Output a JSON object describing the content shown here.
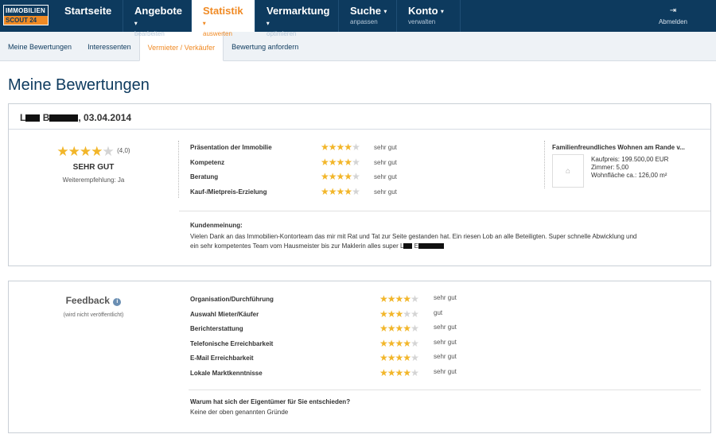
{
  "logo": {
    "line1": "IMMOBILIEN",
    "line2": "SCOUT 24"
  },
  "nav": [
    {
      "label": "Startseite",
      "sub": "",
      "active": false,
      "caret": ""
    },
    {
      "label": "Angebote",
      "sub": "bearbeiten",
      "active": false,
      "caret": "▾"
    },
    {
      "label": "Statistik",
      "sub": "auswerten",
      "active": true,
      "caret": "▾"
    },
    {
      "label": "Vermarktung",
      "sub": "optimieren",
      "active": false,
      "caret": "▾"
    },
    {
      "label": "Suche",
      "sub": "anpassen",
      "active": false,
      "caret": "▾"
    },
    {
      "label": "Konto",
      "sub": "verwalten",
      "active": false,
      "caret": "▾"
    }
  ],
  "logout": {
    "label": "Abmelden",
    "icon": "logout-icon"
  },
  "subnav": [
    {
      "label": "Meine Bewertungen",
      "active": false
    },
    {
      "label": "Interessenten",
      "active": false
    },
    {
      "label": "Vermieter / Verkäufer",
      "active": true
    },
    {
      "label": "Bewertung anfordern",
      "active": false
    }
  ],
  "page_title": "Meine Bewertungen",
  "review": {
    "name_initial": "L",
    "name_initial2": "B",
    "date": ", 03.04.2014",
    "overall_stars": 4,
    "overall_score": "(4,0)",
    "overall_label": "SEHR GUT",
    "recommendation": "Weiterempfehlung: Ja",
    "ratings": [
      {
        "label": "Präsentation der Immobilie",
        "stars": 4,
        "text": "sehr gut"
      },
      {
        "label": "Kompetenz",
        "stars": 4,
        "text": "sehr gut"
      },
      {
        "label": "Beratung",
        "stars": 4,
        "text": "sehr gut"
      },
      {
        "label": "Kauf-/Mietpreis-Erzielung",
        "stars": 4,
        "text": "sehr gut"
      }
    ],
    "property": {
      "title": "Familienfreundliches Wohnen am Rande v...",
      "price": "Kaufpreis: 199.500,00 EUR",
      "rooms": "Zimmer: 5,00",
      "area": "Wohnfläche ca.: 126,00 m²"
    },
    "opinion_heading": "Kundenmeinung:",
    "opinion_text1": "Vielen Dank an das Immobilien-Kontorteam das mir mit Rat und Tat zur Seite gestanden hat. Ein riesen Lob an alle Beteiligten. Super schnelle Abwicklung und",
    "opinion_text2": "ein sehr kompetentes Team vom Hausmeister bis zur Maklerin alles super L",
    "opinion_text2_end": "E"
  },
  "feedback": {
    "title": "Feedback",
    "info_icon": "info-icon",
    "note": "(wird nicht veröffentlicht)",
    "ratings": [
      {
        "label": "Organisation/Durchführung",
        "stars": 4,
        "text": "sehr gut"
      },
      {
        "label": "Auswahl Mieter/Käufer",
        "stars": 3,
        "text": "gut"
      },
      {
        "label": "Berichterstattung",
        "stars": 4,
        "text": "sehr gut"
      },
      {
        "label": "Telefonische Erreichbarkeit",
        "stars": 4,
        "text": "sehr gut"
      },
      {
        "label": "E-Mail Erreichbarkeit",
        "stars": 4,
        "text": "sehr gut"
      },
      {
        "label": "Lokale Marktkenntnisse",
        "stars": 4,
        "text": "sehr gut"
      }
    ],
    "question": "Warum hat sich der Eigentümer für Sie entschieden?",
    "answer": "Keine der oben genannten Gründe"
  },
  "colors": {
    "navy": "#0d3a5e",
    "orange": "#f08a24",
    "star": "#f2b62a"
  }
}
